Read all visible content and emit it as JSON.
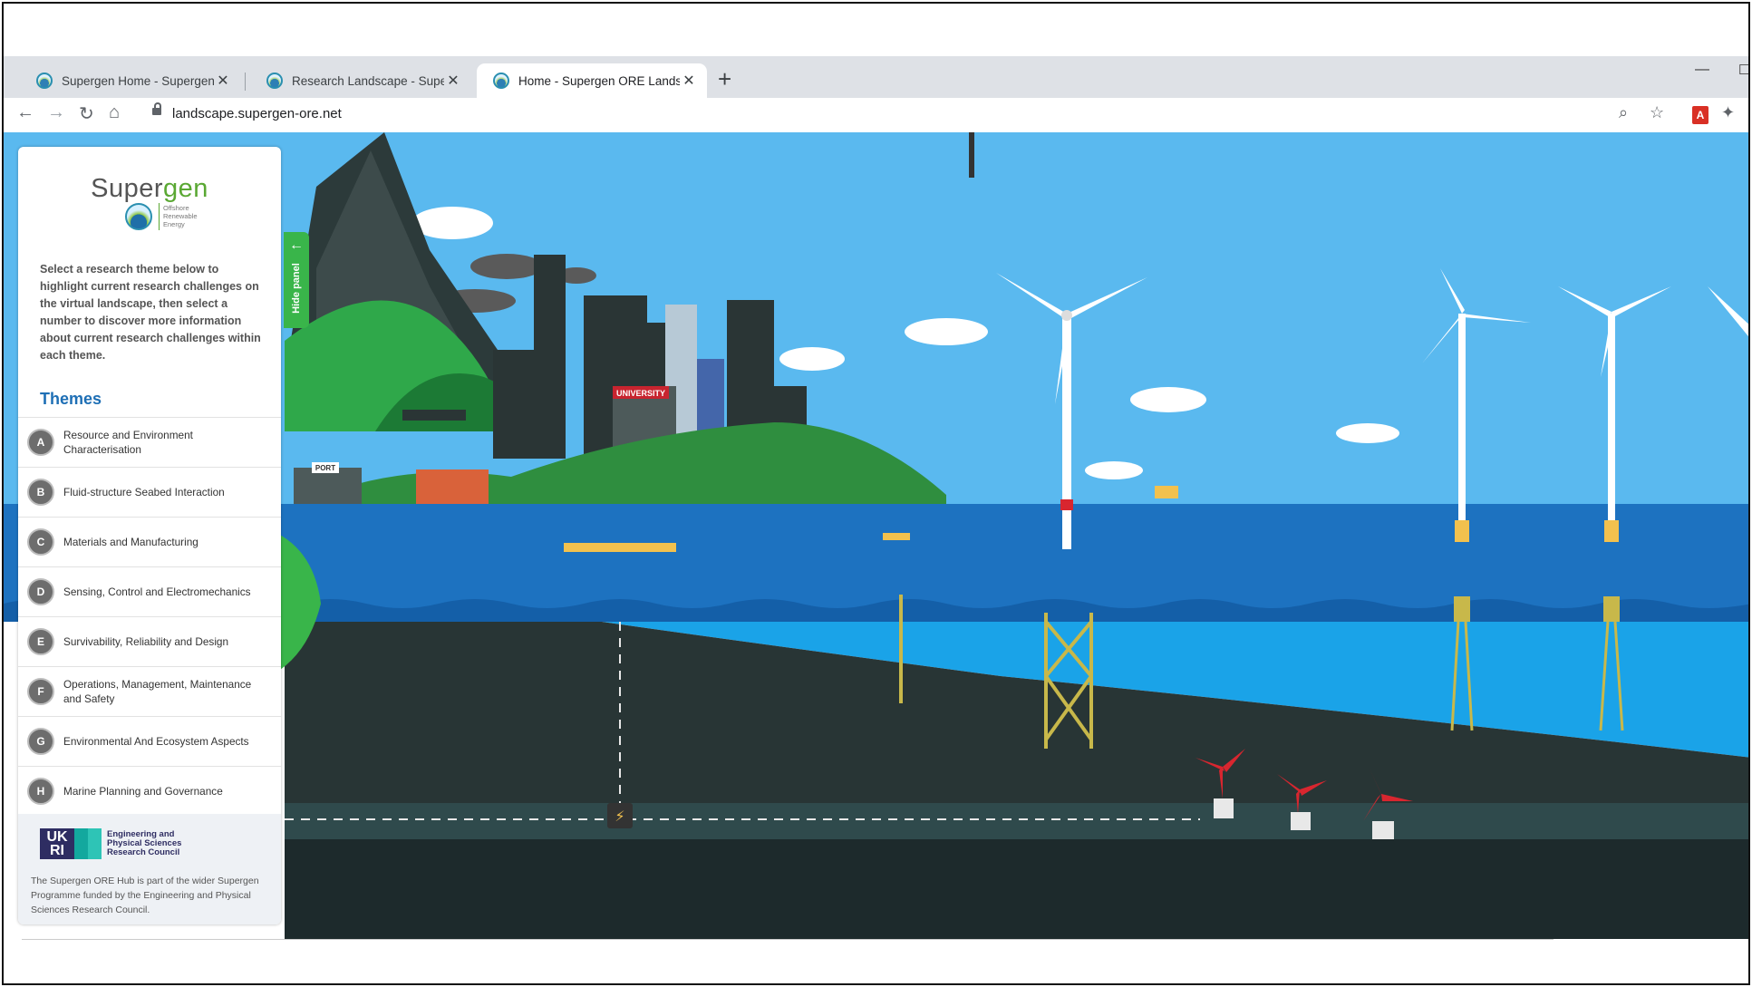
{
  "browser": {
    "tabs": [
      {
        "title": "Supergen Home - Supergen ORE",
        "active": false
      },
      {
        "title": "Research Landscape - Supergen ORE",
        "active": false
      },
      {
        "title": "Home - Supergen ORE Landscape",
        "active": true
      }
    ],
    "new_tab_icon": "plus-icon",
    "url": "landscape.supergen-ore.net"
  },
  "panel": {
    "logo_word_left": "Super",
    "logo_word_right": "gen",
    "logo_subtitle": "Offshore Renewable Energy",
    "intro": "Select a research theme below to highlight current research challenges on the virtual landscape, then select a number to discover more information about current research challenges within each theme.",
    "themes_heading": "Themes",
    "themes": [
      {
        "letter": "A",
        "label": "Resource and Environment Characterisation"
      },
      {
        "letter": "B",
        "label": "Fluid-structure Seabed Interaction"
      },
      {
        "letter": "C",
        "label": "Materials and Manufacturing"
      },
      {
        "letter": "D",
        "label": "Sensing, Control and Electromechanics"
      },
      {
        "letter": "E",
        "label": "Survivability, Reliability and Design"
      },
      {
        "letter": "F",
        "label": "Operations, Management, Maintenance and Safety"
      },
      {
        "letter": "G",
        "label": "Environmental And Ecosystem Aspects"
      },
      {
        "letter": "H",
        "label": "Marine Planning and Governance"
      }
    ],
    "funder_logo_text": "UK RI",
    "funder_name": "Engineering and Physical Sciences Research Council",
    "funder_text": "The Supergen ORE Hub is part of the wider Supergen Programme funded by the Engineering and Physical Sciences Research Council.",
    "hide_label": "Hide panel"
  },
  "scene": {
    "port_sign": "PORT",
    "university_sign": "UNIVERSITY",
    "colors": {
      "sky": "#5ab9ef",
      "sea": "#1d72c0",
      "deep_sea": "#1aa3e8",
      "seabed": "#283535",
      "accent_green": "#39b54a"
    }
  }
}
